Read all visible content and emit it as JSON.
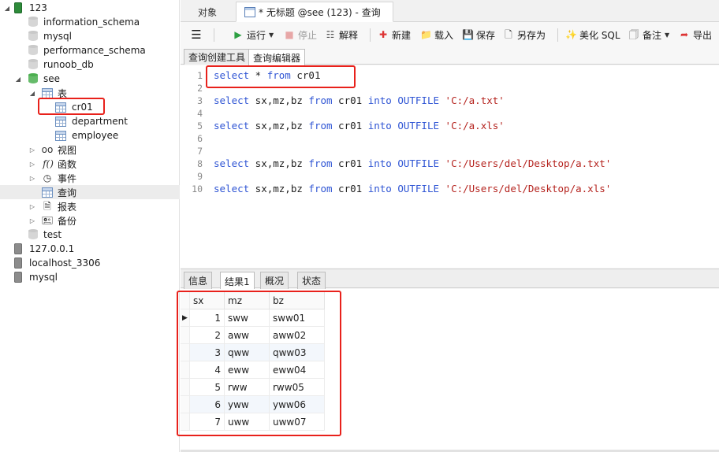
{
  "tree": {
    "connection_123": "123",
    "databases": [
      "information_schema",
      "mysql",
      "performance_schema",
      "runoob_db"
    ],
    "db_see": "see",
    "tables_label": "表",
    "tables": [
      "cr01",
      "department",
      "employee"
    ],
    "views_label": "视图",
    "functions_label": "函数",
    "events_label": "事件",
    "queries_label": "查询",
    "reports_label": "报表",
    "backups_label": "备份",
    "db_test": "test",
    "connections": [
      "127.0.0.1",
      "localhost_3306",
      "mysql"
    ]
  },
  "tabs": {
    "objects": "对象",
    "query_tab": "* 无标题 @see (123) - 查询"
  },
  "toolbar": {
    "run": "运行",
    "stop": "停止",
    "explain": "解释",
    "new": "新建",
    "load": "载入",
    "save": "保存",
    "save_as": "另存为",
    "beautify": "美化 SQL",
    "comment": "备注",
    "export": "导出"
  },
  "subtabs": {
    "builder": "查询创建工具",
    "editor": "查询编辑器"
  },
  "editor": {
    "line_numbers": [
      "1",
      "2",
      "3",
      "4",
      "5",
      "6",
      "7",
      "8",
      "9",
      "10"
    ],
    "line1": {
      "kw1": "select",
      "t1": " * ",
      "kw2": "from",
      "t2": " cr01"
    },
    "line3": {
      "kw1": "select",
      "t1": " sx,mz,bz ",
      "kw2": "from",
      "t2": " cr01 ",
      "kw3": "into",
      "t3": " ",
      "kw4": "OUTFILE",
      "t4": " ",
      "str": "'C:/a.txt'"
    },
    "line5": {
      "kw1": "select",
      "t1": " sx,mz,bz ",
      "kw2": "from",
      "t2": " cr01 ",
      "kw3": "into",
      "t3": " ",
      "kw4": "OUTFILE",
      "t4": " ",
      "str": "'C:/a.xls'"
    },
    "line8": {
      "kw1": "select",
      "t1": " sx,mz,bz ",
      "kw2": "from",
      "t2": " cr01 ",
      "kw3": "into",
      "t3": " ",
      "kw4": "OUTFILE",
      "t4": " ",
      "str": "'C:/Users/del/Desktop/a.txt'"
    },
    "line10": {
      "kw1": "select",
      "t1": " sx,mz,bz ",
      "kw2": "from",
      "t2": " cr01 ",
      "kw3": "into",
      "t3": " ",
      "kw4": "OUTFILE",
      "t4": " ",
      "str": "'C:/Users/del/Desktop/a.xls'"
    }
  },
  "result_tabs": {
    "info": "信息",
    "result1": "结果1",
    "profile": "概况",
    "status": "状态"
  },
  "result": {
    "columns": [
      "sx",
      "mz",
      "bz"
    ],
    "rows": [
      [
        "1",
        "sww",
        "sww01"
      ],
      [
        "2",
        "aww",
        "aww02"
      ],
      [
        "3",
        "qww",
        "qww03"
      ],
      [
        "4",
        "eww",
        "eww04"
      ],
      [
        "5",
        "rww",
        "rww05"
      ],
      [
        "6",
        "yww",
        "yww06"
      ],
      [
        "7",
        "uww",
        "uww07"
      ]
    ]
  },
  "colors": {
    "keyword": "#2f55d4",
    "string": "#b5231e",
    "highlight_box": "#e8211b"
  }
}
